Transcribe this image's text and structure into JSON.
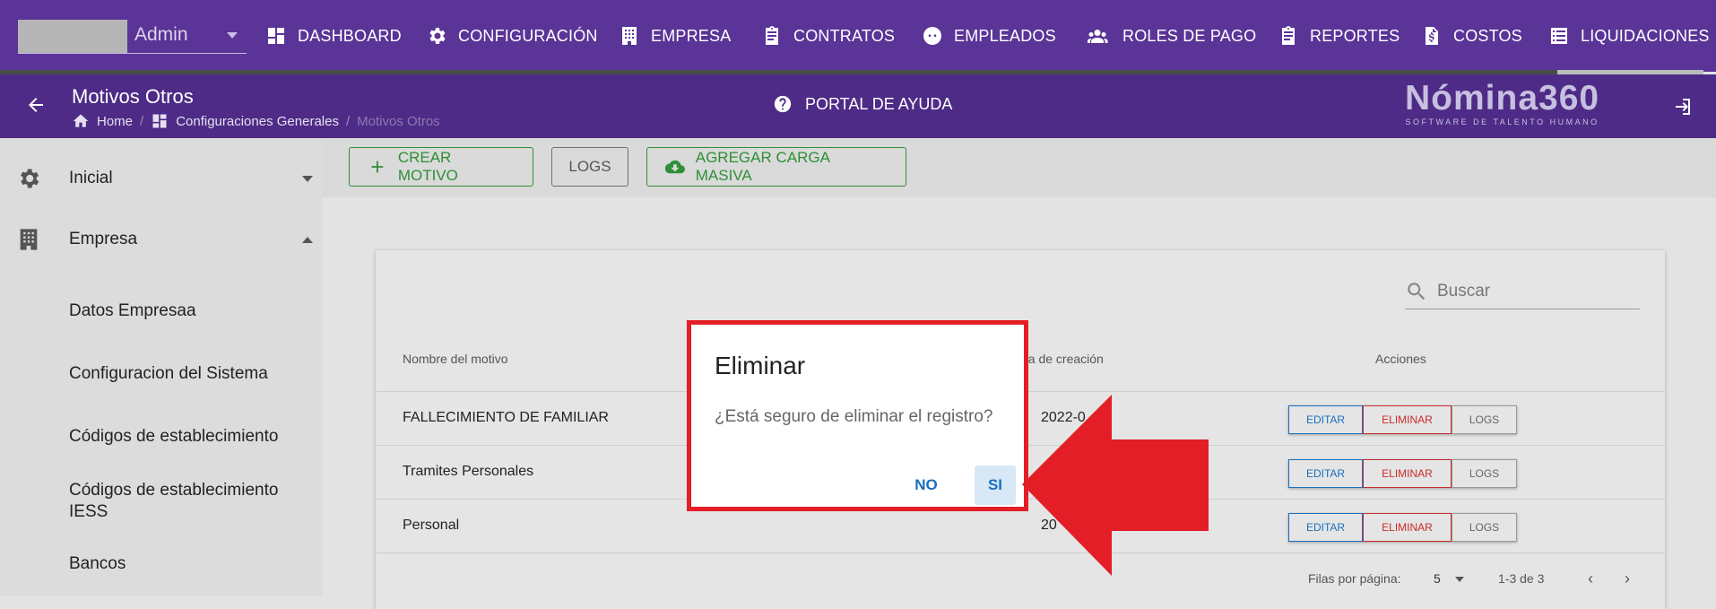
{
  "topnav": {
    "user": "Admin",
    "items": [
      {
        "label": "DASHBOARD",
        "icon": "dashboard-icon"
      },
      {
        "label": "CONFIGURACIÓN",
        "icon": "gear-icon"
      },
      {
        "label": "EMPRESA",
        "icon": "building-icon"
      },
      {
        "label": "CONTRATOS",
        "icon": "clipboard-icon"
      },
      {
        "label": "EMPLEADOS",
        "icon": "face-icon"
      },
      {
        "label": "ROLES DE PAGO",
        "icon": "group-icon"
      },
      {
        "label": "REPORTES",
        "icon": "clipboard-icon"
      },
      {
        "label": "COSTOS",
        "icon": "dollar-file-icon"
      },
      {
        "label": "LIQUIDACIONES",
        "icon": "list-icon"
      }
    ]
  },
  "header": {
    "title": "Motivos Otros",
    "breadcrumb": [
      "Home",
      "Configuraciones Generales",
      "Motivos Otros"
    ],
    "help": "PORTAL DE AYUDA",
    "logo_main": "Nómina360",
    "logo_sub": "SOFTWARE DE TALENTO HUMANO"
  },
  "sidebar": {
    "items": [
      {
        "label": "Inicial"
      },
      {
        "label": "Empresa"
      },
      {
        "label": "Datos Empresaa"
      },
      {
        "label": "Configuracion del Sistema"
      },
      {
        "label": "Códigos de establecimiento"
      },
      {
        "label": "Códigos de establecimiento IESS"
      },
      {
        "label": "Bancos"
      }
    ]
  },
  "toolbar": {
    "create": "CREAR MOTIVO",
    "logs": "LOGS",
    "bulk": "AGREGAR CARGA MASIVA"
  },
  "table": {
    "search_placeholder": "Buscar",
    "columns": [
      "Nombre del motivo",
      "na de creación",
      "Acciones"
    ],
    "rows": [
      {
        "name": "FALLECIMIENTO DE FAMILIAR",
        "date": "2022-0"
      },
      {
        "name": "Tramites Personales",
        "date": ""
      },
      {
        "name": "Personal",
        "date": "20"
      }
    ],
    "actions": {
      "edit": "EDITAR",
      "delete": "ELIMINAR",
      "logs": "LOGS"
    },
    "footer": {
      "rows_label": "Filas por página:",
      "rows_value": "5",
      "range": "1-3 de 3"
    }
  },
  "dialog": {
    "title": "Eliminar",
    "message": "¿Está seguro de eliminar el registro?",
    "no": "NO",
    "yes": "SI"
  },
  "colors": {
    "nav": "#5a3497",
    "subbar": "#4d2b86",
    "highlight": "#e31e26",
    "primary": "#1a6fbe",
    "success": "#2e8f36"
  }
}
